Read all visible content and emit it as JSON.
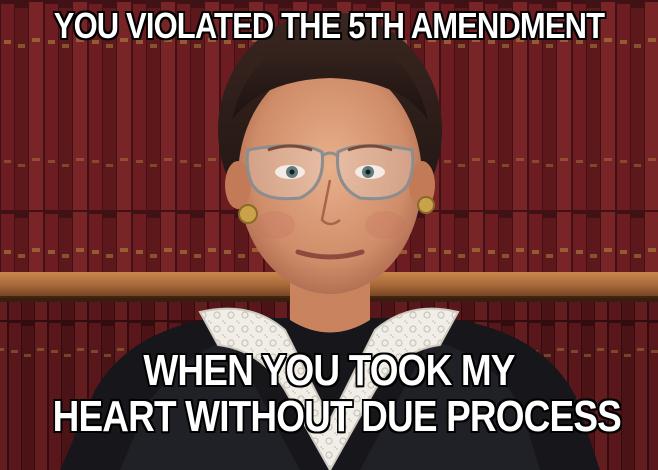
{
  "meme": {
    "top_text": "YOU VIOLATED THE 5TH AMENDMENT",
    "bottom_text": [
      "WHEN YOU TOOK MY",
      "HEART WITHOUT DUE PROCESS"
    ]
  },
  "colors": {
    "caption_fill": "#ffffff",
    "caption_outline": "#000000",
    "bookshelf_wood": "#a86a3a",
    "book_red": "#7a1f22",
    "robe": "#1a1a1f",
    "collar_lace": "#efece6"
  }
}
